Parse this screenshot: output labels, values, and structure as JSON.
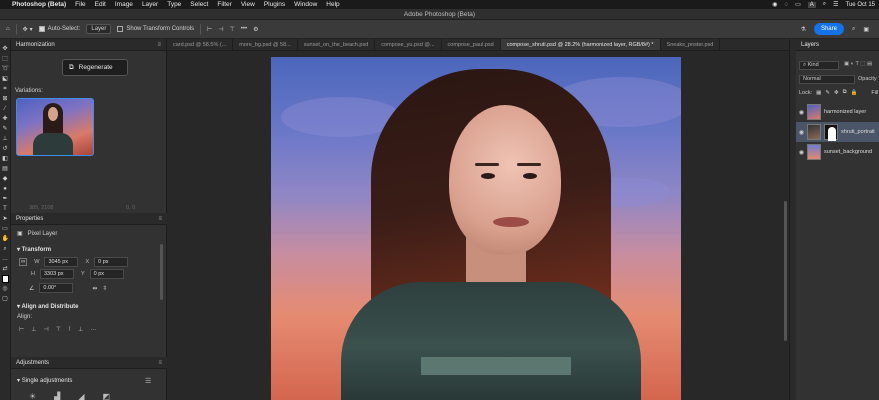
{
  "menubar": {
    "app_name": "Photoshop (Beta)",
    "items": [
      "File",
      "Edit",
      "Image",
      "Layer",
      "Type",
      "Select",
      "Filter",
      "View",
      "Plugins",
      "Window",
      "Help"
    ],
    "status_badge": "A",
    "date": "Tue Oct 15"
  },
  "titlebar": {
    "title": "Adobe Photoshop (Beta)"
  },
  "options": {
    "auto_select_label": "Auto-Select:",
    "auto_select_value": "Layer",
    "transform_controls_label": "Show Transform Controls",
    "more_label": "•••",
    "share_label": "Share"
  },
  "harmonization": {
    "tab_label": "Harmonization",
    "regenerate_label": "Regenerate",
    "variations_label": "Variations:",
    "faded_left": "385, 2108",
    "faded_right": "0, 0"
  },
  "properties": {
    "tab_label": "Properties",
    "kind_label": "Pixel Layer",
    "transform_title": "Transform",
    "w_label": "W",
    "w_value": "3045 px",
    "h_label": "H",
    "h_value": "3303 px",
    "x_label": "X",
    "x_value": "0 px",
    "y_label": "Y",
    "y_value": "0 px",
    "angle_value": "0.00°",
    "align_title": "Align and Distribute",
    "align_label": "Align:"
  },
  "adjustments": {
    "tab_label": "Adjustments",
    "single_label": "Single adjustments"
  },
  "doc_tabs": [
    {
      "label": "card.psd @ 58.5% (..."
    },
    {
      "label": "more_bg.psd @ 58..."
    },
    {
      "label": "sunset_on_the_beach.psd"
    },
    {
      "label": "compose_yu.psd @..."
    },
    {
      "label": "compose_paul.psd"
    },
    {
      "label": "compose_shruti.psd @ 28.2% (harmonized layer, RGB/8#) *"
    },
    {
      "label": "Sneaks_poster.psd"
    }
  ],
  "layers": {
    "tab_label": "Layers",
    "kind_value": "Kind",
    "blend_mode": "Normal",
    "opacity_label": "Opacity",
    "lock_label": "Lock:",
    "fill_label": "Fill",
    "items": [
      {
        "name": "harmonized layer"
      },
      {
        "name": "shruti_portrait"
      },
      {
        "name": "sunset_background"
      }
    ]
  },
  "colors": {
    "accent": "#1473e6",
    "selected_layer": "#4a5668"
  }
}
